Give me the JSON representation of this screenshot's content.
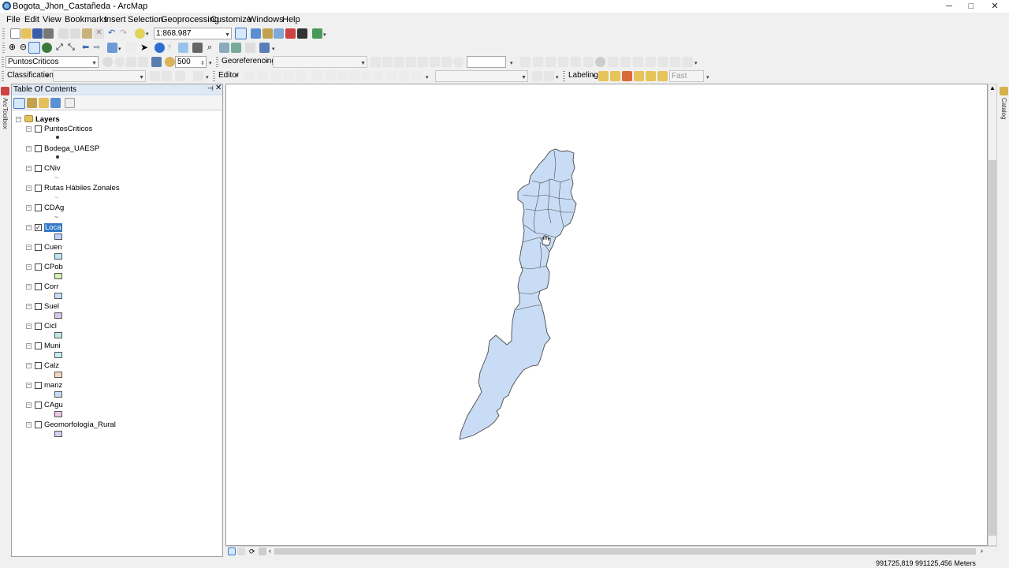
{
  "window": {
    "title": "Bogota_Jhon_Castañeda - ArcMap",
    "minimize": "─",
    "maximize": "□",
    "close": "✕"
  },
  "menu": [
    "File",
    "Edit",
    "View",
    "Bookmarks",
    "Insert",
    "Selection",
    "Geoprocessing",
    "Customize",
    "Windows",
    "Help"
  ],
  "toolbars": {
    "scale": "1:868.987",
    "layer_select": "PuntosCriticos",
    "buffer_value": "500",
    "georeferencing": "Georeferencing",
    "classification": "Classification",
    "editor": "Editor",
    "labeling": "Labeling",
    "label_quality": "Fast"
  },
  "toc": {
    "title": "Table Of Contents",
    "root": "Layers",
    "layers": [
      {
        "name": "PuntosCriticos",
        "checked": false,
        "symbol": "point",
        "color": "#333333"
      },
      {
        "name": "Bodega_UAESP",
        "checked": false,
        "symbol": "point",
        "color": "#333333"
      },
      {
        "name": "CNiv",
        "checked": false,
        "symbol": "line",
        "color": "#4aa37a"
      },
      {
        "name": "Rutas Hábiles Zonales",
        "checked": false,
        "symbol": "line",
        "color": "#6fbf8a"
      },
      {
        "name": "CDAg",
        "checked": false,
        "symbol": "line",
        "color": "#444444"
      },
      {
        "name": "Loca",
        "checked": true,
        "selected": true,
        "symbol": "polygon",
        "color": "#bed2ff"
      },
      {
        "name": "Cuen",
        "checked": false,
        "symbol": "polygon",
        "color": "#bde7f5"
      },
      {
        "name": "CPob",
        "checked": false,
        "symbol": "polygon",
        "color": "#d3f0b4"
      },
      {
        "name": "Corr",
        "checked": false,
        "symbol": "polygon",
        "color": "#c7e0f7"
      },
      {
        "name": "Suel",
        "checked": false,
        "symbol": "polygon",
        "color": "#d9c8ef"
      },
      {
        "name": "Cicl",
        "checked": false,
        "symbol": "polygon",
        "color": "#bfe9e6"
      },
      {
        "name": "Muni",
        "checked": false,
        "symbol": "polygon",
        "color": "#c4ecef"
      },
      {
        "name": "Calz",
        "checked": false,
        "symbol": "polygon",
        "color": "#f7d6bf"
      },
      {
        "name": "manz",
        "checked": false,
        "symbol": "polygon",
        "color": "#c8dcf6"
      },
      {
        "name": "CAgu",
        "checked": false,
        "symbol": "polygon",
        "color": "#ecc6e6"
      },
      {
        "name": "Geomorfología_Rural",
        "checked": false,
        "symbol": "polygon",
        "color": "#d8cdf2"
      }
    ]
  },
  "docks": {
    "left": "ArcToolbox",
    "right": "Catalog"
  },
  "map": {
    "polygon_fill": "#c9dcf5",
    "polygon_stroke": "#4a4a4a"
  },
  "status": {
    "coordinates": "991725,819  991125,456 Meters"
  }
}
